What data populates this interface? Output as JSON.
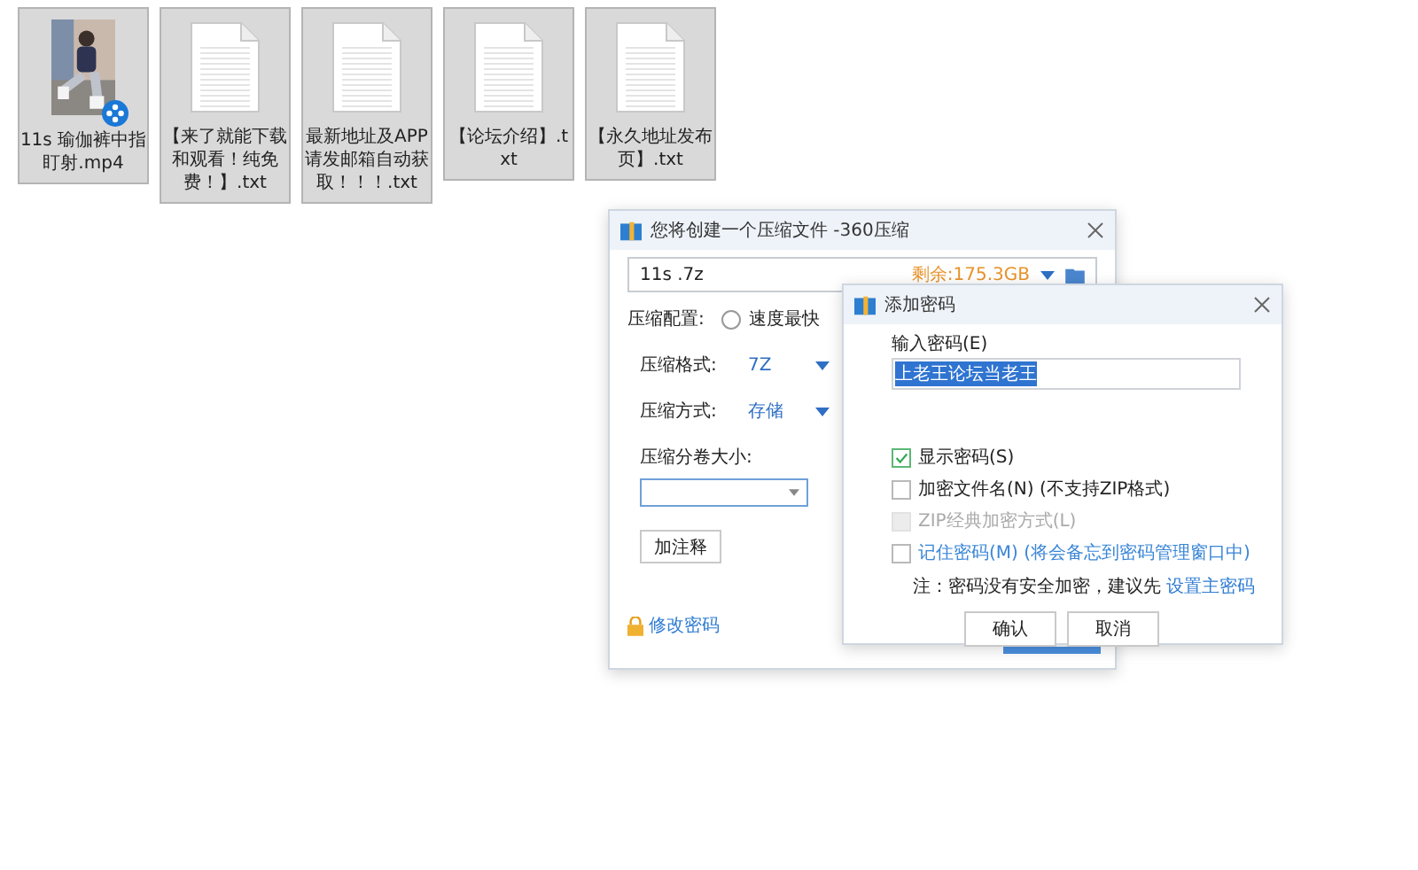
{
  "files": [
    {
      "kind": "video",
      "name": "11s  瑜伽裤中指盯射.mp4"
    },
    {
      "kind": "text",
      "name": "【来了就能下载和观看！纯免费！】.txt"
    },
    {
      "kind": "text",
      "name": "最新地址及APP请发邮箱自动获取！！！.txt"
    },
    {
      "kind": "text",
      "name": "【论坛介绍】.txt"
    },
    {
      "kind": "text",
      "name": "【永久地址发布页】.txt"
    }
  ],
  "compress_dialog": {
    "title": "您将创建一个压缩文件 -360压缩",
    "path": "11s  .7z",
    "free_space": "剩余:175.3GB",
    "profile_label": "压缩配置:",
    "profile_option": {
      "label": "速度最快",
      "selected": false
    },
    "settings": [
      {
        "label": "压缩格式:",
        "value": "7Z"
      },
      {
        "label": "压缩方式:",
        "value": "存储"
      }
    ],
    "volume_label": "压缩分卷大小:",
    "comment_button": "加注释",
    "change_password": "修改密码"
  },
  "password_dialog": {
    "title": "添加密码",
    "input_label": "输入密码(E)",
    "password": "上老王论坛当老王",
    "options": [
      {
        "label": "显示密码(S)",
        "checked": true,
        "disabled": false,
        "kind": "plain"
      },
      {
        "label": "加密文件名(N) (不支持ZIP格式)",
        "checked": false,
        "disabled": false,
        "kind": "plain"
      },
      {
        "label": "ZIP经典加密方式(L)",
        "checked": false,
        "disabled": true,
        "kind": "plain"
      },
      {
        "label": "记住密码(M) (将会备忘到密码管理窗口中)",
        "checked": false,
        "disabled": false,
        "kind": "link"
      }
    ],
    "note": "注：密码没有安全加密，建议先",
    "note_link": "设置主密码",
    "buttons": [
      "确认",
      "取消"
    ]
  }
}
